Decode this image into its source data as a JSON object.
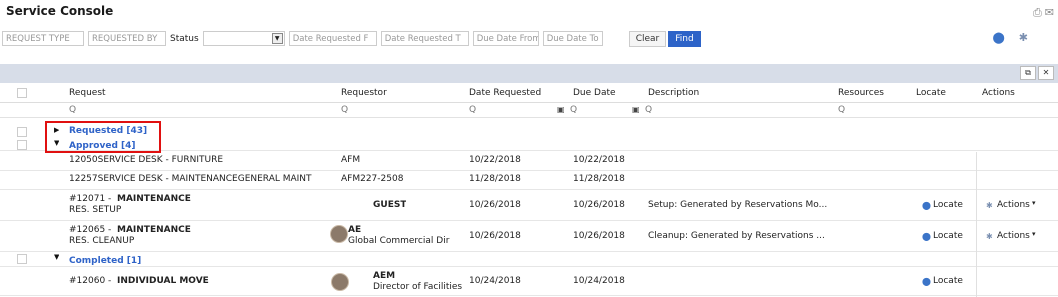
{
  "app": {
    "title": "Service Console"
  },
  "filters": {
    "request_type": "REQUEST TYPE",
    "requested_by": "REQUESTED BY",
    "status_label": "Status",
    "date_requested_from": "Date Requested F",
    "date_requested_to": "Date Requested T",
    "due_date_from": "Due Date From",
    "due_date_to": "Due Date To",
    "clear": "Clear",
    "find": "Find"
  },
  "columns": {
    "request": "Request",
    "requestor": "Requestor",
    "date_requested": "Date Requested",
    "due_date": "Due Date",
    "description": "Description",
    "resources": "Resources",
    "locate": "Locate",
    "actions": "Actions"
  },
  "search_glyph": "Q",
  "groups": {
    "requested": "Requested [43]",
    "approved": "Approved [4]",
    "completed": "Completed [1]"
  },
  "rows": [
    {
      "request": "12050SERVICE DESK - FURNITURE",
      "requestor": "AFM",
      "date_requested": "10/22/2018",
      "due_date": "10/22/2018"
    },
    {
      "request": "12257SERVICE DESK - MAINTENANCEGENERAL MAINT",
      "requestor": "AFM227-2508",
      "date_requested": "11/28/2018",
      "due_date": "11/28/2018"
    },
    {
      "request_id": "#12071 - ",
      "request_type": "MAINTENANCE",
      "request_sub": "RES. SETUP",
      "requestor": "GUEST",
      "date_requested": "10/26/2018",
      "due_date": "10/26/2018",
      "description": "Setup: Generated by Reservations Mo...",
      "locate": "Locate",
      "actions": "Actions"
    },
    {
      "request_id": "#12065 - ",
      "request_type": "MAINTENANCE",
      "request_sub": "RES. CLEANUP",
      "requestor_name": "AE",
      "requestor_sub": "Global Commercial Dir",
      "date_requested": "10/26/2018",
      "due_date": "10/26/2018",
      "description": "Cleanup: Generated by Reservations ...",
      "locate": "Locate",
      "actions": "Actions"
    },
    {
      "request_id": "#12060 - ",
      "request_type": "INDIVIDUAL MOVE",
      "requestor_name": "AEM",
      "requestor_sub": "Director of Facilities",
      "date_requested": "10/24/2018",
      "due_date": "10/24/2018",
      "locate": "Locate"
    }
  ],
  "icons": [
    "print-icon",
    "email-icon",
    "pin-icon",
    "gear-icon",
    "pin-icon",
    "gear-icon",
    "calendar-icon",
    "expand-icon",
    "close-icon"
  ],
  "colors": {
    "accent": "#2d63c8",
    "link": "#2f63c8",
    "band": "#d7dde8",
    "highlight": "#e01010"
  }
}
